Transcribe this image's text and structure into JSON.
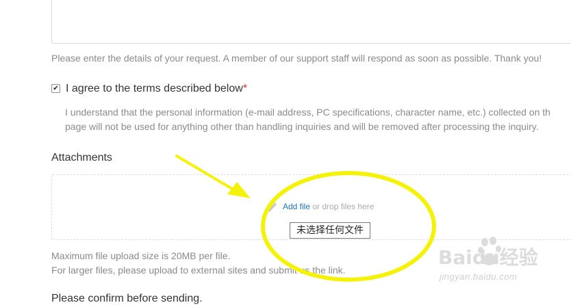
{
  "request": {
    "hint": "Please enter the details of your request. A member of our support staff will respond as soon as possible. Thank you!"
  },
  "terms": {
    "checked": true,
    "check_glyph": "✔",
    "label": "I agree to the terms described below",
    "required_mark": "*",
    "text_line1": "I understand that the personal information (e-mail address, PC specifications, character name, etc.) collected on th",
    "text_line2": "page will not be used for anything other than handling inquiries and will be removed after processing the inquiry."
  },
  "attachments": {
    "title": "Attachments",
    "add_file": "Add file",
    "drop_text": "or drop files here",
    "file_input_label": "未选择任何文件",
    "note_line1": "Maximum file upload size is 20MB per file.",
    "note_line2": "For larger files, please upload to external sites and submit us the link."
  },
  "next_section": {
    "heading": "Please confirm before sending."
  },
  "watermark": {
    "brand": "Baidu经验",
    "url": "jingyan.baidu.com"
  },
  "colors": {
    "highlight": "#f5f20a",
    "link": "#1f73b7",
    "required": "#e0262d"
  }
}
